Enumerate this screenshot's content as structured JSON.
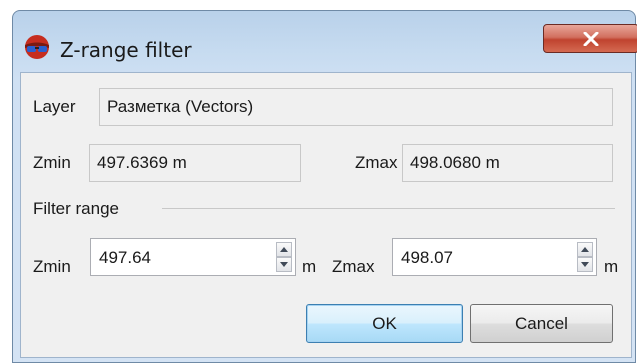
{
  "window": {
    "title": "Z-range filter",
    "icon": "glasses-3d-icon",
    "close_icon": "close-icon"
  },
  "layer": {
    "label": "Layer",
    "value": "Разметка (Vectors)"
  },
  "current_range": {
    "zmin_label": "Zmin",
    "zmin_value": "497.6369 m",
    "zmax_label": "Zmax",
    "zmax_value": "498.0680 m"
  },
  "filter_range": {
    "group_label": "Filter range",
    "zmin_label": "Zmin",
    "zmin_value": "497.64",
    "zmin_unit": "m",
    "zmax_label": "Zmax",
    "zmax_value": "498.07",
    "zmax_unit": "m"
  },
  "buttons": {
    "ok": "OK",
    "cancel": "Cancel"
  },
  "colors": {
    "accent": "#3c7fb1",
    "close_button": "#c0432f"
  }
}
